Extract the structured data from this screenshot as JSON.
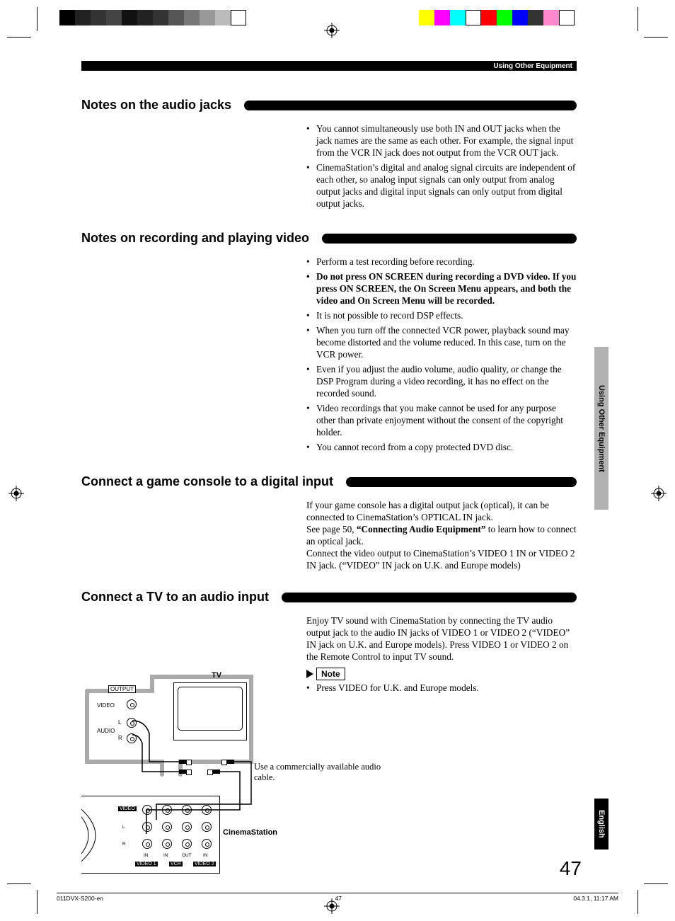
{
  "print_marks": {
    "color_swatches_left": [
      "#000",
      "#333",
      "#555",
      "#777",
      "#999",
      "#bbb",
      "#ddd",
      "#fff"
    ],
    "color_swatches_right": [
      "#ffff00",
      "#ff00ff",
      "#00ffff",
      "#00ff00",
      "#ff0000",
      "#0000ff",
      "#808080",
      "#ff88cc",
      "#ffffff"
    ]
  },
  "header": {
    "breadcrumb": "Using Other Equipment"
  },
  "sections": {
    "audio_jacks": {
      "title": "Notes on the audio jacks",
      "bullets": [
        "You cannot simultaneously use both IN and OUT jacks when the jack names are the same as each other. For example, the signal input from the VCR IN jack does not output from the VCR OUT jack.",
        "CinemaStation’s digital and analog signal circuits are independent of each other, so analog input signals can only output from analog output jacks and digital input signals can only output from digital output jacks."
      ]
    },
    "recording": {
      "title": "Notes on recording and playing video",
      "bullets": [
        "Perform a test recording before recording.",
        "Do not press ON SCREEN during recording a DVD video. If you press ON SCREEN, the On Screen Menu appears, and both the video and On Screen Menu will be recorded.",
        "It is not possible to record DSP effects.",
        "When you turn off the connected VCR power, playback sound may become distorted and the volume reduced. In this case, turn on the VCR power.",
        "Even if you adjust the audio volume, audio quality, or change the DSP Program during a video recording, it has no effect on the recorded sound.",
        "Video recordings that you make cannot be used for any purpose other than private enjoyment without the consent of the copyright holder.",
        "You cannot record from a copy protected DVD disc."
      ],
      "bold_index": 1
    },
    "game_console": {
      "title": "Connect a game console to a digital input",
      "para": "If your game console has a digital output jack (optical), it can be connected to CinemaStation’s OPTICAL IN jack.",
      "see_prefix": "See page 50, ",
      "see_bold": "“Connecting Audio Equipment”",
      "see_suffix": " to learn how to connect an optical jack.",
      "para2": "Connect the video output to CinemaStation’s VIDEO 1 IN or VIDEO 2 IN jack. (“VIDEO” IN jack on U.K. and Europe models)"
    },
    "tv_audio": {
      "title": "Connect a TV to an audio input",
      "para": "Enjoy TV sound with CinemaStation by connecting the TV audio output jack to the audio IN jacks of VIDEO 1 or VIDEO 2 (“VIDEO” IN jack on U.K. and Europe models). Press VIDEO 1 or VIDEO 2 on the Remote Control to input TV sound.",
      "note_label": "Note",
      "note_bullet": "Press VIDEO for U.K. and Europe models."
    }
  },
  "diagram": {
    "tv_label": "TV",
    "output_label": "OUTPUT",
    "video_label": "VIDEO",
    "audio_label": "AUDIO",
    "l_label": "L",
    "r_label": "R",
    "cable_note": "Use a commercially available audio cable.",
    "cinemastation_label": "CinemaStation",
    "panel": {
      "video_row": "VIDEO",
      "l_row": "L",
      "r_row": "R",
      "in1": "IN",
      "in2": "IN",
      "out": "OUT",
      "in3": "IN",
      "video1": "VIDEO 1",
      "vcr": "VCR",
      "video2": "VIDEO 2"
    }
  },
  "side_tabs": {
    "section": "Using Other Equipment",
    "language": "English"
  },
  "page_number": "47",
  "footer": {
    "file": "011DVX-S200-en",
    "page": "47",
    "timestamp": "04.3.1, 11:17 AM"
  }
}
